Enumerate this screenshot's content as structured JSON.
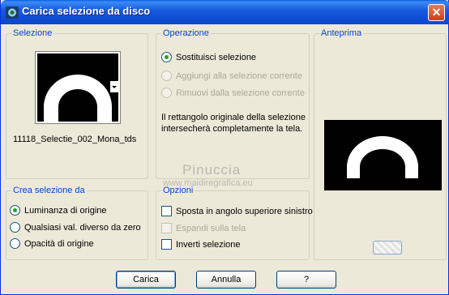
{
  "window": {
    "title": "Carica selezione da disco",
    "close_glyph": "✕"
  },
  "selezione": {
    "legend": "Selezione",
    "filename": "11118_Selectie_002_Mona_tds"
  },
  "operazione": {
    "legend": "Operazione",
    "options": [
      {
        "label": "Sostituisci selezione",
        "checked": true,
        "disabled": false
      },
      {
        "label": "Aggiungi alla selezione corrente",
        "checked": false,
        "disabled": true
      },
      {
        "label": "Rimuovi dalla selezione corrente",
        "checked": false,
        "disabled": true
      }
    ],
    "description": "Il rettangolo originale della selezione intersecherà completamente la tela."
  },
  "anteprima": {
    "legend": "Anteprima"
  },
  "crea": {
    "legend": "Crea selezione da",
    "options": [
      {
        "label": "Luminanza di origine",
        "checked": true
      },
      {
        "label": "Qualsiasi val. diverso da zero",
        "checked": false
      },
      {
        "label": "Opacità di origine",
        "checked": false
      }
    ]
  },
  "opzioni": {
    "legend": "Opzioni",
    "items": [
      {
        "label": "Sposta in angolo superiore sinistro",
        "checked": false,
        "disabled": false
      },
      {
        "label": "Espandi sulla tela",
        "checked": false,
        "disabled": true
      },
      {
        "label": "Inverti selezione",
        "checked": false,
        "disabled": false
      }
    ]
  },
  "buttons": {
    "load": "Carica",
    "cancel": "Annulla",
    "help": "?"
  },
  "watermark": {
    "name": "Pinuccia",
    "url": "www.maidiregrafica.eu"
  },
  "colors": {
    "titlebar": "#0f4fd6",
    "legend": "#0046d5",
    "dialog_bg": "#ece9d8"
  }
}
